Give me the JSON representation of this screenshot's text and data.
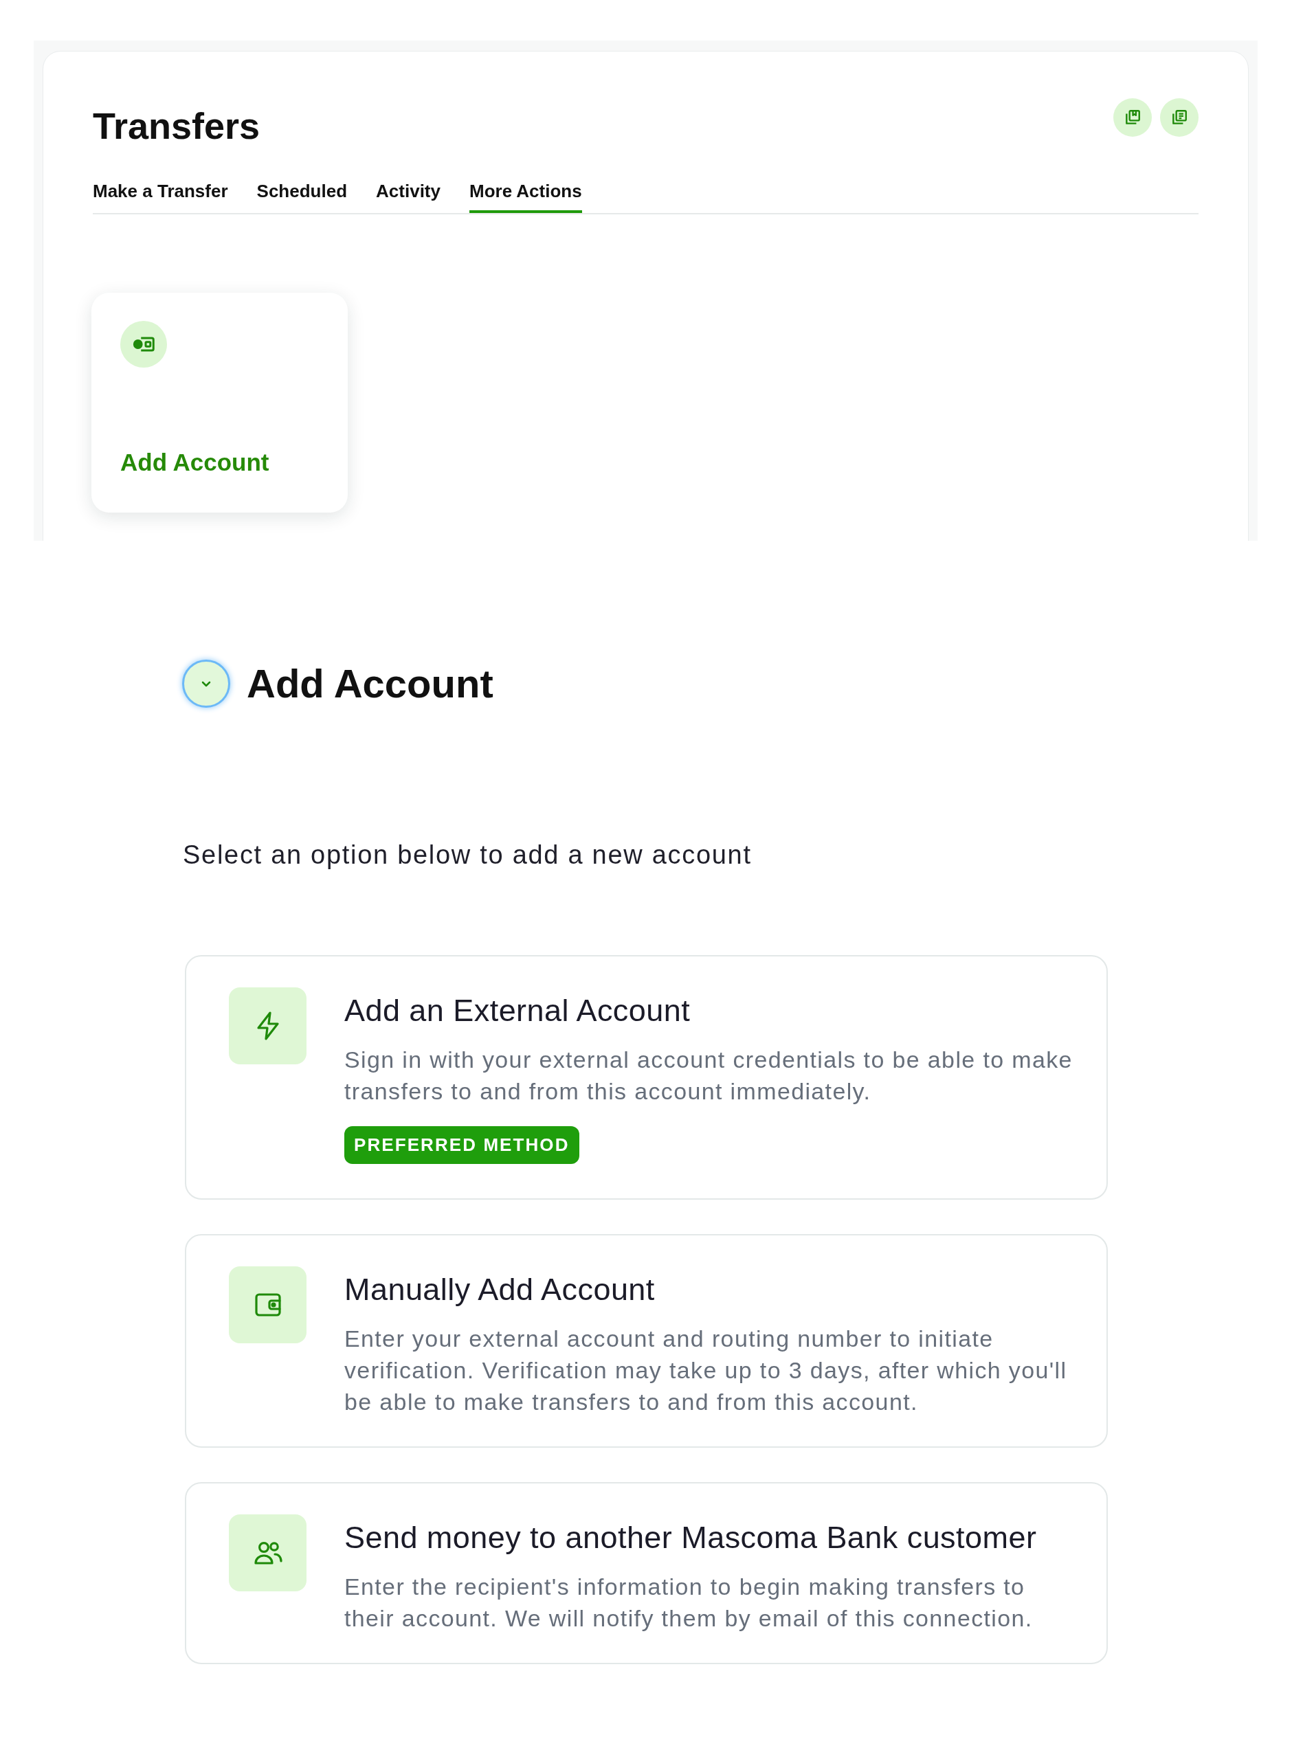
{
  "header": {
    "title": "Transfers"
  },
  "tabs": [
    {
      "label": "Make a Transfer",
      "selected": false
    },
    {
      "label": "Scheduled",
      "selected": false
    },
    {
      "label": "Activity",
      "selected": false
    },
    {
      "label": "More Actions",
      "selected": true
    }
  ],
  "quick_actions": [
    {
      "label": "Add Account"
    }
  ],
  "section": {
    "title": "Add Account",
    "expanded": true,
    "focused": true,
    "intro": "Select an option below to add a new account",
    "options": [
      {
        "title": "Add an External Account",
        "description": "Sign in with your external account credentials to be able to make transfers to and from this account immediately.",
        "badge": "PREFERRED METHOD"
      },
      {
        "title": "Manually Add Account",
        "description": "Enter your external account and routing number to initiate verification. Verification may take up to 3 days, after which you'll be able to make transfers to and from this account."
      },
      {
        "title": "Send money to another Mascoma Bank customer",
        "description": "Enter the recipient's information to begin making transfers to their account. We will notify them by email of this connection."
      }
    ]
  }
}
